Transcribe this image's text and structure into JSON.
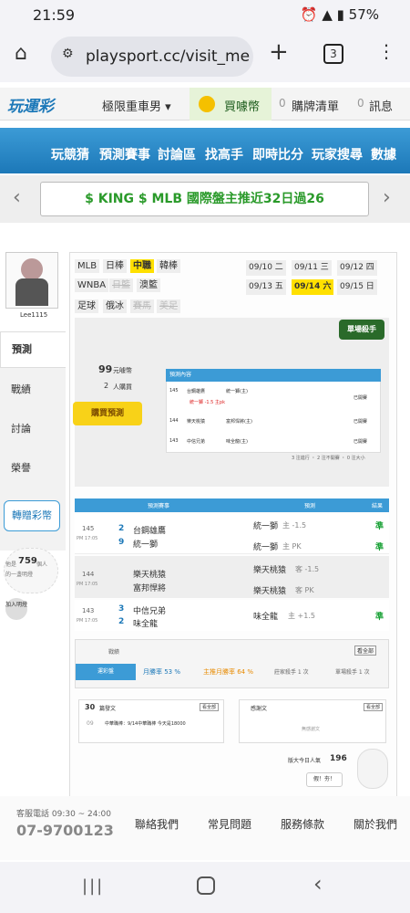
{
  "status": {
    "time": "21:59",
    "battery": "57%"
  },
  "browser": {
    "url": "playsport.cc/visit_mem",
    "tab_count": "3"
  },
  "header": {
    "logo": "玩運彩",
    "user": "極限重車男 ▾",
    "buy": "買噱幣",
    "buy_count": "0",
    "cart": "購牌清單",
    "msg_count": "0",
    "msg": "訊息"
  },
  "nav": [
    "玩競猜",
    "預測賽事",
    "討論區",
    "找高手",
    "即時比分",
    "玩家搜尋",
    "數據"
  ],
  "promo": {
    "text": "$ KING $ MLB 國際盤主推近32日過26"
  },
  "profile": {
    "name": "Lee1115"
  },
  "side": [
    "預測",
    "戰績",
    "討論",
    "榮譽"
  ],
  "gift": "轉贈彩幣",
  "visitors": {
    "label_pre": "他是",
    "count": "759",
    "label_post": "個人",
    "sub": "的一盞明燈"
  },
  "join": "加入明燈",
  "sports": [
    "MLB",
    "日棒",
    "中職",
    "韓棒",
    "WNBA",
    "日籃",
    "澳籃",
    "足球",
    "俄冰",
    "賽馬",
    "美足"
  ],
  "dates": [
    "09/10 二",
    "09/11 三",
    "09/12 四",
    "09/13 五",
    "09/14 六",
    "09/15 日"
  ],
  "killer": "單場殺手",
  "price": {
    "value": "99",
    "unit": "元噱幣",
    "buyers": "2",
    "buyers_unit": "人購買",
    "buy_btn": "購買預測"
  },
  "mini": {
    "title": "預測內容",
    "rows": [
      {
        "no": "145",
        "t1": "台鋼雄鷹",
        "t2": "統一獅(主)",
        "pick": "統一獅 -1.5 主pk",
        "status": "已開賽"
      },
      {
        "no": "144",
        "t1": "樂天桃猿",
        "t2": "富邦悍將(主)",
        "pick": "",
        "status": "已開賽"
      },
      {
        "no": "143",
        "t1": "中信兄弟",
        "t2": "味全龍(主)",
        "pick": "",
        "status": "已開賽"
      }
    ],
    "footer": "3 注進行 ・ 2 注不開賽 ・ 0 注大小"
  },
  "table": {
    "headers": [
      "預測賽事",
      "預測",
      "結果"
    ],
    "rows": [
      {
        "no": "145",
        "time": "PM 17:05",
        "s1": "2",
        "t1": "台鋼雄鷹",
        "s2": "9",
        "t2": "統一獅",
        "p1": "統一獅",
        "p1s": "主 -1.5",
        "r1": "準",
        "p2": "統一獅",
        "p2s": "主 PK",
        "r2": "準"
      },
      {
        "no": "144",
        "time": "PM 17:05",
        "s1": "",
        "t1": "樂天桃猿",
        "s2": "",
        "t2": "富邦悍將",
        "p1": "樂天桃猿",
        "p1s": "客 -1.5",
        "r1": "",
        "p2": "樂天桃猿",
        "p2s": "客 PK",
        "r2": ""
      },
      {
        "no": "143",
        "time": "PM 17:05",
        "s1": "3",
        "t1": "中信兄弟",
        "s2": "2",
        "t2": "味全龍",
        "p1": "味全龍",
        "p1s": "主 +1.5",
        "r1": "準",
        "p2": "",
        "p2s": "",
        "r2": ""
      }
    ]
  },
  "record": {
    "title": "戰績",
    "more": "看全部",
    "tabs": [
      "運彩盤",
      "月勝率 53 %",
      "主推月勝率 64 %",
      "莊家殺手 1 次",
      "單場殺手 1 次"
    ]
  },
  "posts": {
    "count": "30",
    "title": "篇發文",
    "more": "看全部",
    "item": "中華職棒：9/14中華職棒 今天是18000",
    "item_no": "09",
    "right_title": "感謝文",
    "right_more": "看全部",
    "empty": "無感謝文"
  },
  "today": {
    "label": "版大今日人氣",
    "count": "196",
    "btn": "假！夯！"
  },
  "footer": {
    "hours": "客服電話 09:30 ~ 24:00",
    "phone": "07-9700123",
    "links": [
      "聯絡我們",
      "常見問題",
      "服務條款",
      "關於我們"
    ]
  },
  "colors": {
    "nav": "#1c78b8",
    "green": "#16a033",
    "yellow": "#ffe000"
  }
}
